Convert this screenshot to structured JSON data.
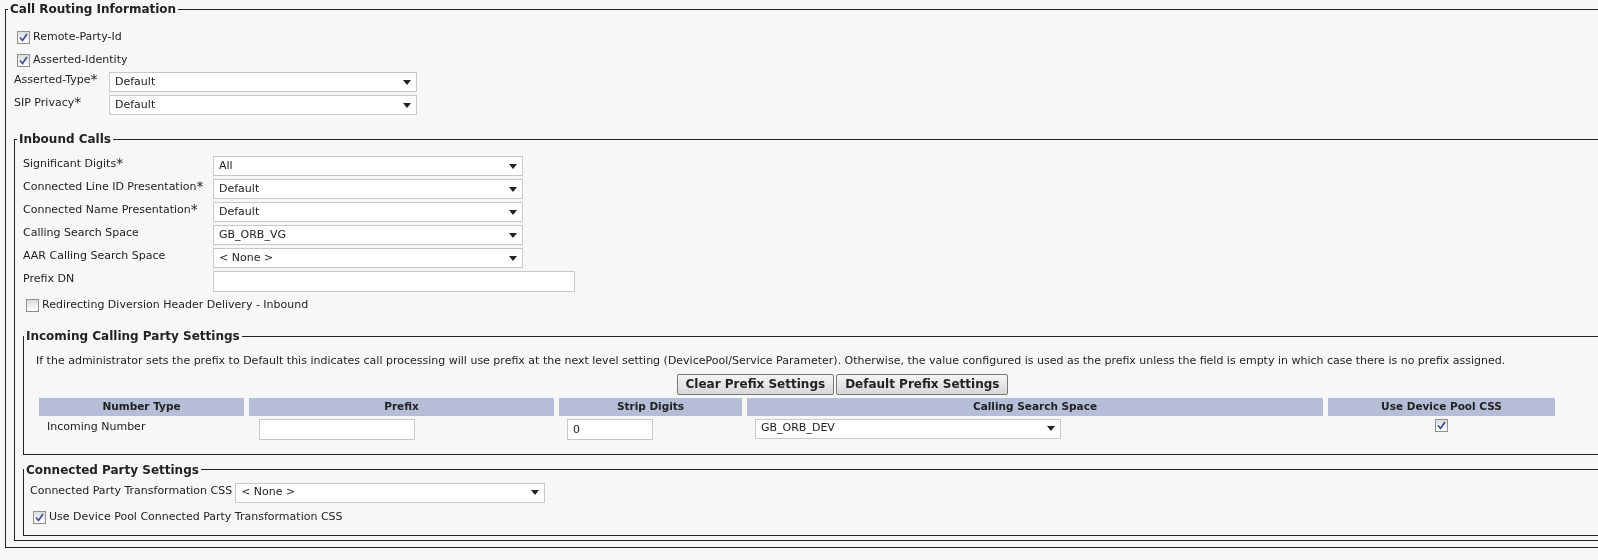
{
  "section": {
    "title": "Call Routing Information",
    "checkboxes": [
      {
        "label": "Remote-Party-Id",
        "checked": true
      },
      {
        "label": "Asserted-Identity",
        "checked": true
      }
    ],
    "fields": [
      {
        "label": "Asserted-Type",
        "required_mark": "*",
        "kind": "select",
        "value": "Default"
      },
      {
        "label": "SIP Privacy",
        "required_mark": "*",
        "kind": "select",
        "value": "Default"
      }
    ],
    "inbound": {
      "title": "Inbound Calls",
      "fields": [
        {
          "label": "Significant Digits",
          "required_mark": "*",
          "kind": "select",
          "value": "All"
        },
        {
          "label": "Connected Line ID Presentation",
          "required_mark": "*",
          "kind": "select",
          "value": "Default"
        },
        {
          "label": "Connected Name Presentation",
          "required_mark": "*",
          "kind": "select",
          "value": "Default"
        },
        {
          "label": "Calling Search Space",
          "kind": "select",
          "value": "GB_ORB_VG"
        },
        {
          "label": "AAR Calling Search Space",
          "kind": "select",
          "value": "< None >"
        },
        {
          "label": "Prefix DN",
          "kind": "text"
        }
      ],
      "checkboxes": [
        {
          "label": "Redirecting Diversion Header Delivery - Inbound",
          "checked": false
        }
      ],
      "incoming": {
        "title": "Incoming Calling Party Settings",
        "note": "If the administrator sets the prefix to Default this indicates call processing will use prefix at the next level setting (DevicePool/Service Parameter). Otherwise, the value configured is used as the prefix unless the field is empty in which case there is no prefix assigned.",
        "buttons": [
          "Clear Prefix Settings",
          "Default Prefix Settings"
        ],
        "table": {
          "columns": [
            "Number Type",
            "Prefix",
            "Strip Digits",
            "Calling Search Space",
            "Use Device Pool CSS"
          ],
          "rows": [
            [
              {
                "kind": "label",
                "value": "Incoming Number"
              },
              {
                "kind": "text"
              },
              {
                "kind": "text",
                "value": "0"
              },
              {
                "kind": "select",
                "value": "GB_ORB_DEV"
              },
              {
                "kind": "checkbox",
                "checked": true
              }
            ]
          ]
        }
      }
    },
    "connected": {
      "title": "Connected Party Settings",
      "fields": [
        {
          "label": "Connected Party Transformation CSS",
          "kind": "select",
          "value": "< None >"
        }
      ],
      "checkboxes": [
        {
          "label": "Use Device Pool Connected Party Transformation CSS",
          "checked": true
        }
      ]
    }
  }
}
